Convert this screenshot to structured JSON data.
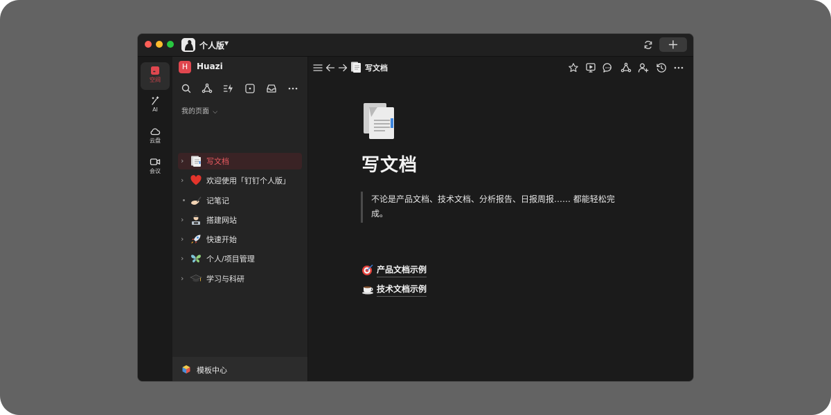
{
  "titlebar": {
    "workspace_name": "个人版"
  },
  "rail": {
    "items": [
      {
        "label": "空间",
        "icon": "space-icon",
        "active": true
      },
      {
        "label": "AI",
        "icon": "magic-wand-icon",
        "active": false
      },
      {
        "label": "云盘",
        "icon": "cloud-icon",
        "active": false
      },
      {
        "label": "会议",
        "icon": "video-icon",
        "active": false
      }
    ]
  },
  "sidebar": {
    "space_initial": "H",
    "space_name": "Huazi",
    "tools": [
      "search-icon",
      "share-nodes-icon",
      "quick-action-icon",
      "ai-box-icon",
      "inbox-icon",
      "more-icon"
    ],
    "section_label": "我的页面",
    "items": [
      {
        "label": "写文档",
        "icon": "document-emoji",
        "active": true,
        "has_children": true
      },
      {
        "label": "欢迎使用「钉钉个人版」",
        "icon": "red-heart-emoji",
        "active": false,
        "has_children": true
      },
      {
        "label": "记笔记",
        "icon": "writing-hand-emoji",
        "active": false,
        "has_children": false
      },
      {
        "label": "搭建网站",
        "icon": "technologist-emoji",
        "active": false,
        "has_children": true
      },
      {
        "label": "快速开始",
        "icon": "rocket-emoji",
        "active": false,
        "has_children": true
      },
      {
        "label": "个人/项目管理",
        "icon": "butterfly-emoji",
        "active": false,
        "has_children": true
      },
      {
        "label": "学习与科研",
        "icon": "graduation-cap-emoji",
        "active": false,
        "has_children": true
      }
    ],
    "footer_label": "模板中心"
  },
  "main": {
    "breadcrumb_title": "写文档",
    "toolbar_icons": [
      "star-icon",
      "present-icon",
      "comment-icon",
      "share-nodes-icon",
      "add-user-icon",
      "history-icon",
      "more-icon"
    ],
    "doc": {
      "title": "写文档",
      "quote": "不论是产品文档、技术文档、分析报告、日报周报…… 都能轻松完成。",
      "links": [
        {
          "label": "产品文档示例",
          "icon": "dart-emoji"
        },
        {
          "label": "技术文档示例",
          "icon": "coffee-emoji"
        }
      ]
    }
  },
  "colors": {
    "accent": "#e0474f",
    "window_bg": "#1b1b1b",
    "sidebar_bg": "#242424",
    "backdrop": "#636363"
  }
}
